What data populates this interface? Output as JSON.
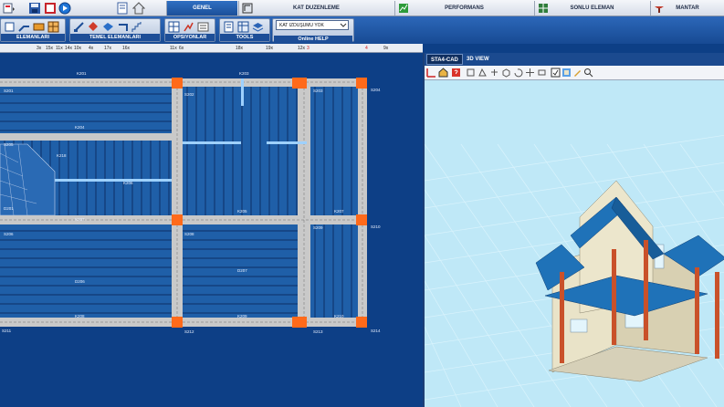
{
  "tabs": [
    {
      "label": "GENEL",
      "active": true
    },
    {
      "label": "KAT DUZENLEME",
      "active": false
    },
    {
      "label": "PERFORMANS",
      "active": false
    },
    {
      "label": "SONLU ELEMAN",
      "active": false
    },
    {
      "label": "MANTAR",
      "active": false
    }
  ],
  "ribbon": {
    "groups": [
      {
        "label": "ELEMANLARI"
      },
      {
        "label": "TEMEL ELEMANLARI"
      },
      {
        "label": "OPSIYONLAR"
      },
      {
        "label": "TOOLS"
      }
    ],
    "floor_select": "KAT IZDUŞUMU YOK",
    "help_label": "Online HELP"
  },
  "ruler": {
    "ticks": [
      "3x",
      "15x",
      "11x",
      "14x",
      "10x",
      "4x",
      "17x",
      "16x",
      "11x",
      "6x",
      "18x",
      "19x",
      "12x",
      "3",
      "4",
      "9x"
    ]
  },
  "plan": {
    "labels": {
      "S201": "S201",
      "K201": "K201",
      "S202": "S202",
      "S203": "S203",
      "S204": "S204",
      "K204": "K204",
      "S205": "S205",
      "K218": "K218",
      "K206": "K206",
      "K207": "K207",
      "D201": "D201",
      "K205": "K205",
      "K207b": "K207",
      "S210": "S210",
      "S206": "S206",
      "S208": "S208",
      "S209": "S209",
      "K209": "K209",
      "D206": "D206",
      "D207": "D207",
      "K208": "K208",
      "K209b": "K209",
      "K210": "K210",
      "S211": "S211",
      "S212": "S212",
      "S213": "S213",
      "S214": "S214",
      "K203": "K203"
    }
  },
  "view3d": {
    "tabs": [
      {
        "label": "STA4-CAD",
        "active": true
      },
      {
        "label": "3D VIEW",
        "active": false
      }
    ]
  },
  "colors": {
    "plan_bg": "#0d3f86",
    "slab": "#1f5fa8",
    "beam": "#c9c9c9",
    "column": "#ff6a1a",
    "roof": "#1f72b8",
    "wall": "#e9e3c8",
    "sky": "#bfe8f7"
  }
}
